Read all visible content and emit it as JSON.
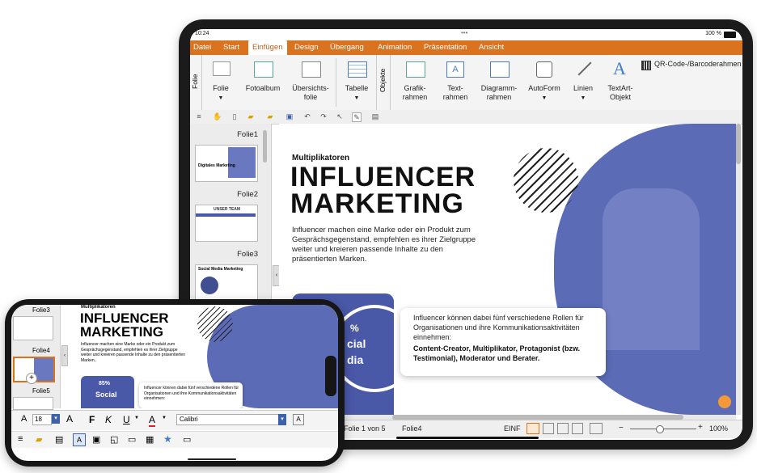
{
  "tablet": {
    "status": {
      "time": "10:24",
      "battery": "100 %"
    },
    "menu": [
      "Datei",
      "Start",
      "Einfügen",
      "Design",
      "Übergang",
      "Animation",
      "Präsentation",
      "Ansicht"
    ],
    "active_menu": "Einfügen",
    "ribbon": {
      "side_label_left": "Folie",
      "side_label_mid": "Objekte",
      "folie": "Folie",
      "fotoalbum": "Fotoalbum",
      "uebersicht": "Übersichts-\nfolie",
      "tabelle": "Tabelle",
      "grafik": "Grafik-\nrahmen",
      "text": "Text-\nrahmen",
      "diagramm": "Diagramm-\nrahmen",
      "autoform": "AutoForm",
      "linien": "Linien",
      "textart": "TextArt-\nObjekt",
      "qr": "QR-Code-/Barcoderahmen"
    },
    "thumbs": [
      {
        "label": "Folie1",
        "caption": "Digitales Marketing"
      },
      {
        "label": "Folie2",
        "caption": "UNSER TEAM"
      },
      {
        "label": "Folie3",
        "caption": "Social Media Marketing"
      }
    ],
    "slide": {
      "kicker": "Multiplikatoren",
      "title_line1": "INFLUENCER",
      "title_line2": "MARKETING",
      "body": "Influencer machen eine Marke oder ein Produkt zum Gesprächsgegenstand, empfehlen es ihrer Zielgruppe weiter und kreieren passende Inhalte zu den präsentierten Marken.",
      "circle_text1": "%",
      "circle_text2": "cial",
      "circle_text3": "dia",
      "callout_intro": "Influencer können dabei fünf verschiedene Rollen für Organisationen und ihre Kommunikationsaktivitäten einnehmen:",
      "callout_bold": "Content-Creator, Multiplikator, Protagonist (bzw. Testimonial), Moderator und Berater."
    },
    "statusbar": {
      "slide_of": "Folie 1 von 5",
      "slide_name": "Folie4",
      "mode": "EINF",
      "zoom": "100%"
    }
  },
  "phone": {
    "thumbs": [
      "Folie3",
      "Folie4",
      "Folie5"
    ],
    "slide": {
      "kicker": "Multiplikatoren",
      "title_line1": "INFLUENCER",
      "title_line2": "MARKETING",
      "body": "Influencer machen eine Marke oder ein Produkt zum Gesprächsgegenstand, empfehlen es ihrer Zielgruppe weiter und kreieren passende Inhalte zu den präsentierten Marken.",
      "circle_pct": "85%",
      "circle_label": "Social",
      "callout": "Influencer können dabei fünf verschiedene Rollen für Organisationen und ihre Kommunikationsaktivitäten einnehmen:"
    },
    "format": {
      "font_size": "18",
      "bold": "F",
      "italic": "K",
      "underline": "U",
      "color_letter": "A",
      "font_name": "Calibri"
    }
  },
  "colors": {
    "accent": "#d9731f",
    "slide_blue": "#5b6bb5",
    "circle_blue": "#4a58a8"
  }
}
